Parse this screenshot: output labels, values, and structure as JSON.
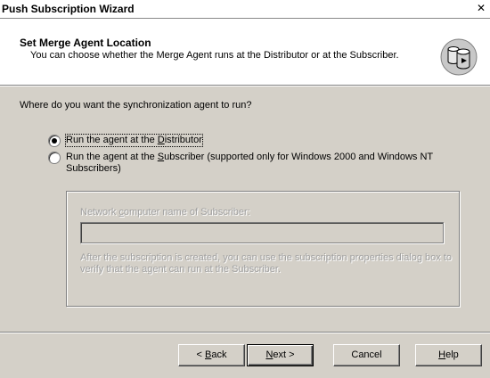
{
  "window": {
    "title": "Push Subscription Wizard",
    "close_glyph": "✕"
  },
  "header": {
    "title": "Set Merge Agent Location",
    "description": "You can choose whether the Merge Agent runs at the Distributor or at the Subscriber.",
    "icon": "database-cylinders-icon"
  },
  "main": {
    "question": "Where do you want the synchronization agent to run?",
    "options": [
      {
        "pre": "Run the agent at the ",
        "access": "D",
        "post": "istributor",
        "selected": true,
        "checked": true
      },
      {
        "pre": "Run the agent at the ",
        "access": "S",
        "post": "ubscriber (supported only for Windows 2000 and Windows NT Subscribers)",
        "selected": false,
        "checked": false
      }
    ],
    "subscriber_group": {
      "label_pre": "Network ",
      "label_access": "c",
      "label_post": "omputer name of Subscriber:",
      "input_value": "",
      "help": "After the subscription is created, you can use the subscription properties dialog box to verify that the agent can run at the Subscriber."
    }
  },
  "buttons": {
    "back": {
      "pre": "< ",
      "access": "B",
      "post": "ack"
    },
    "next": {
      "pre": "",
      "access": "N",
      "post": "ext >"
    },
    "cancel": {
      "label": "Cancel"
    },
    "help": {
      "pre": "",
      "access": "H",
      "post": "elp"
    }
  }
}
